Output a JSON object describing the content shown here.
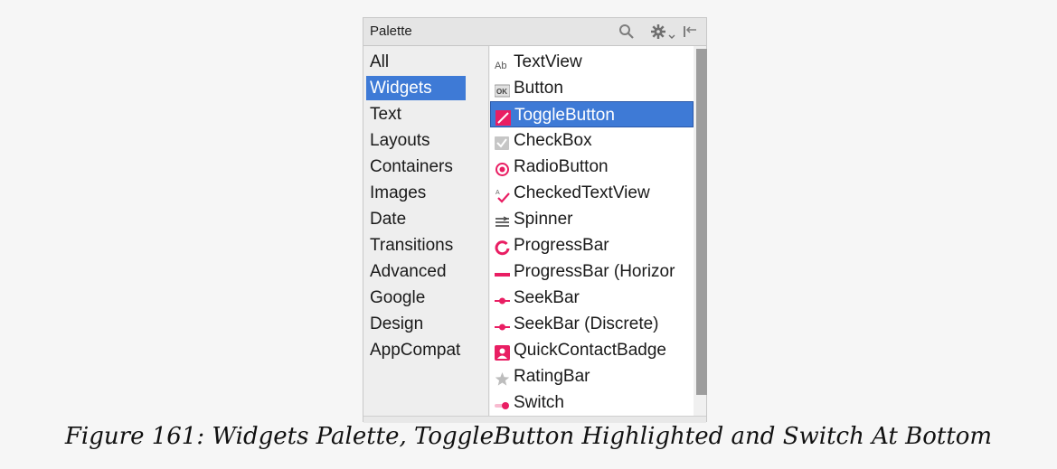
{
  "palette": {
    "title": "Palette",
    "toolbar_icons": [
      "search-icon",
      "gear-icon",
      "chevron-down-icon",
      "collapse-icon"
    ],
    "categories": [
      {
        "label": "All"
      },
      {
        "label": "Widgets",
        "selected": true
      },
      {
        "label": "Text"
      },
      {
        "label": "Layouts"
      },
      {
        "label": "Containers"
      },
      {
        "label": "Images"
      },
      {
        "label": "Date"
      },
      {
        "label": "Transitions"
      },
      {
        "label": "Advanced"
      },
      {
        "label": "Google"
      },
      {
        "label": "Design"
      },
      {
        "label": "AppCompat"
      }
    ],
    "widgets": [
      {
        "label": "TextView",
        "icon": "textview-icon"
      },
      {
        "label": "Button",
        "icon": "button-icon"
      },
      {
        "label": "ToggleButton",
        "icon": "togglebutton-icon",
        "selected": true
      },
      {
        "label": "CheckBox",
        "icon": "checkbox-icon"
      },
      {
        "label": "RadioButton",
        "icon": "radiobutton-icon"
      },
      {
        "label": "CheckedTextView",
        "icon": "checkedtextview-icon"
      },
      {
        "label": "Spinner",
        "icon": "spinner-icon"
      },
      {
        "label": "ProgressBar",
        "icon": "progressbar-icon"
      },
      {
        "label": "ProgressBar (Horizor",
        "icon": "progressbar-horizontal-icon"
      },
      {
        "label": "SeekBar",
        "icon": "seekbar-icon"
      },
      {
        "label": "SeekBar (Discrete)",
        "icon": "seekbar-discrete-icon"
      },
      {
        "label": "QuickContactBadge",
        "icon": "quickcontactbadge-icon"
      },
      {
        "label": "RatingBar",
        "icon": "ratingbar-icon"
      },
      {
        "label": "Switch",
        "icon": "switch-icon"
      }
    ],
    "accent_color": "#e91e63",
    "selection_color": "#3e7ad6"
  },
  "caption": "Figure 161: Widgets Palette, ToggleButton Highlighted and Switch At Bottom"
}
